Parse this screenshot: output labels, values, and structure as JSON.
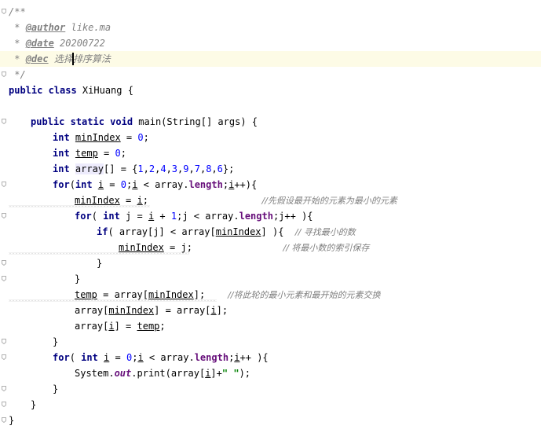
{
  "lines": [
    {
      "indent": 0,
      "tokens": [
        {
          "t": "/**",
          "c": "doc"
        }
      ]
    },
    {
      "indent": 0,
      "tokens": [
        {
          "t": " * ",
          "c": "doc"
        },
        {
          "t": "@author",
          "c": "tag"
        },
        {
          "t": " like.ma",
          "c": "doc"
        }
      ]
    },
    {
      "indent": 0,
      "tokens": [
        {
          "t": " * ",
          "c": "doc"
        },
        {
          "t": "@date",
          "c": "tag"
        },
        {
          "t": " 20200722",
          "c": "doc"
        }
      ]
    },
    {
      "indent": 0,
      "tokens": [
        {
          "t": " * ",
          "c": "doc"
        },
        {
          "t": "@dec",
          "c": "tag"
        },
        {
          "t": " 选择排序算法",
          "c": "doc"
        }
      ]
    },
    {
      "indent": 0,
      "tokens": [
        {
          "t": " */",
          "c": "doc"
        }
      ]
    },
    {
      "indent": 0,
      "tokens": [
        {
          "t": "public class ",
          "c": "kw"
        },
        {
          "t": "XiHuang {",
          "c": ""
        }
      ]
    },
    {
      "indent": 0,
      "tokens": []
    },
    {
      "indent": 1,
      "tokens": [
        {
          "t": "public static void ",
          "c": "kw"
        },
        {
          "t": "main(String[] args) {",
          "c": ""
        }
      ]
    },
    {
      "indent": 2,
      "tokens": [
        {
          "t": "int ",
          "c": "kw"
        },
        {
          "t": "minIndex",
          "c": "ul"
        },
        {
          "t": " = ",
          "c": ""
        },
        {
          "t": "0",
          "c": "num"
        },
        {
          "t": ";",
          "c": ""
        }
      ]
    },
    {
      "indent": 2,
      "tokens": [
        {
          "t": "int ",
          "c": "kw"
        },
        {
          "t": "temp",
          "c": "ul"
        },
        {
          "t": " = ",
          "c": ""
        },
        {
          "t": "0",
          "c": "num"
        },
        {
          "t": ";",
          "c": ""
        }
      ]
    },
    {
      "indent": 2,
      "tokens": [
        {
          "t": "int ",
          "c": "kw"
        },
        {
          "t": "array",
          "c": "hl"
        },
        {
          "t": "[] = {",
          "c": ""
        },
        {
          "t": "1",
          "c": "num"
        },
        {
          "t": ",",
          "c": ""
        },
        {
          "t": "2",
          "c": "num"
        },
        {
          "t": ",",
          "c": ""
        },
        {
          "t": "4",
          "c": "num"
        },
        {
          "t": ",",
          "c": ""
        },
        {
          "t": "3",
          "c": "num"
        },
        {
          "t": ",",
          "c": ""
        },
        {
          "t": "9",
          "c": "num"
        },
        {
          "t": ",",
          "c": ""
        },
        {
          "t": "7",
          "c": "num"
        },
        {
          "t": ",",
          "c": ""
        },
        {
          "t": "8",
          "c": "num"
        },
        {
          "t": ",",
          "c": ""
        },
        {
          "t": "6",
          "c": "num"
        },
        {
          "t": "};",
          "c": ""
        }
      ]
    },
    {
      "indent": 2,
      "tokens": [
        {
          "t": "for",
          "c": "kw"
        },
        {
          "t": "(",
          "c": ""
        },
        {
          "t": "int ",
          "c": "kw"
        },
        {
          "t": "i",
          "c": "ul"
        },
        {
          "t": " = ",
          "c": ""
        },
        {
          "t": "0",
          "c": "num"
        },
        {
          "t": ";",
          "c": ""
        },
        {
          "t": "i",
          "c": "ul"
        },
        {
          "t": " < array.",
          "c": ""
        },
        {
          "t": "length",
          "c": "fld"
        },
        {
          "t": ";",
          "c": ""
        },
        {
          "t": "i",
          "c": "ul"
        },
        {
          "t": "++){",
          "c": ""
        }
      ]
    },
    {
      "indent": 3,
      "tokens": [
        {
          "t": "minIndex",
          "c": "ul"
        },
        {
          "t": " = ",
          "c": ""
        },
        {
          "t": "i",
          "c": "ul"
        },
        {
          "t": ";                    ",
          "c": ""
        },
        {
          "t": "//先假设最开始的元素为最小的元素",
          "c": "cmt-cn"
        }
      ]
    },
    {
      "indent": 3,
      "tokens": [
        {
          "t": "for",
          "c": "kw"
        },
        {
          "t": "( ",
          "c": ""
        },
        {
          "t": "int ",
          "c": "kw"
        },
        {
          "t": "j = ",
          "c": ""
        },
        {
          "t": "i",
          "c": "ul"
        },
        {
          "t": " + ",
          "c": ""
        },
        {
          "t": "1",
          "c": "num"
        },
        {
          "t": ";j < array.",
          "c": ""
        },
        {
          "t": "length",
          "c": "fld"
        },
        {
          "t": ";j++ ){",
          "c": ""
        }
      ]
    },
    {
      "indent": 4,
      "tokens": [
        {
          "t": "if",
          "c": "kw"
        },
        {
          "t": "( array[j] < array[",
          "c": ""
        },
        {
          "t": "minIndex",
          "c": "ul"
        },
        {
          "t": "] ){  ",
          "c": ""
        },
        {
          "t": "// 寻找最小的数",
          "c": "cmt-cn"
        }
      ]
    },
    {
      "indent": 5,
      "tokens": [
        {
          "t": "minIndex",
          "c": "ul"
        },
        {
          "t": " = j;                ",
          "c": ""
        },
        {
          "t": "// 将最小数的索引保存",
          "c": "cmt-cn"
        }
      ]
    },
    {
      "indent": 4,
      "tokens": [
        {
          "t": "}",
          "c": ""
        }
      ]
    },
    {
      "indent": 3,
      "tokens": [
        {
          "t": "}",
          "c": ""
        }
      ]
    },
    {
      "indent": 3,
      "tokens": [
        {
          "t": "temp",
          "c": "ul"
        },
        {
          "t": " = array[",
          "c": ""
        },
        {
          "t": "minIndex",
          "c": "ul"
        },
        {
          "t": "];    ",
          "c": ""
        },
        {
          "t": "//将此轮的最小元素和最开始的元素交换",
          "c": "cmt-cn"
        }
      ]
    },
    {
      "indent": 3,
      "tokens": [
        {
          "t": "array[",
          "c": ""
        },
        {
          "t": "minIndex",
          "c": "ul"
        },
        {
          "t": "] = array[",
          "c": ""
        },
        {
          "t": "i",
          "c": "ul"
        },
        {
          "t": "];",
          "c": ""
        }
      ]
    },
    {
      "indent": 3,
      "tokens": [
        {
          "t": "array[",
          "c": ""
        },
        {
          "t": "i",
          "c": "ul"
        },
        {
          "t": "] = ",
          "c": ""
        },
        {
          "t": "temp",
          "c": "ul"
        },
        {
          "t": ";",
          "c": ""
        }
      ]
    },
    {
      "indent": 2,
      "tokens": [
        {
          "t": "}",
          "c": ""
        }
      ]
    },
    {
      "indent": 2,
      "tokens": [
        {
          "t": "for",
          "c": "kw"
        },
        {
          "t": "( ",
          "c": ""
        },
        {
          "t": "int ",
          "c": "kw"
        },
        {
          "t": "i",
          "c": "ul"
        },
        {
          "t": " = ",
          "c": ""
        },
        {
          "t": "0",
          "c": "num"
        },
        {
          "t": ";",
          "c": ""
        },
        {
          "t": "i",
          "c": "ul"
        },
        {
          "t": " < array.",
          "c": ""
        },
        {
          "t": "length",
          "c": "fld"
        },
        {
          "t": ";",
          "c": ""
        },
        {
          "t": "i",
          "c": "ul"
        },
        {
          "t": "++ ){",
          "c": ""
        }
      ]
    },
    {
      "indent": 3,
      "tokens": [
        {
          "t": "System.",
          "c": ""
        },
        {
          "t": "out",
          "c": "sfld"
        },
        {
          "t": ".print(array[",
          "c": ""
        },
        {
          "t": "i",
          "c": "ul"
        },
        {
          "t": "]+",
          "c": ""
        },
        {
          "t": "\" \"",
          "c": "str"
        },
        {
          "t": ");",
          "c": ""
        }
      ]
    },
    {
      "indent": 2,
      "tokens": [
        {
          "t": "}",
          "c": ""
        }
      ]
    },
    {
      "indent": 1,
      "tokens": [
        {
          "t": "}",
          "c": ""
        }
      ]
    },
    {
      "indent": 0,
      "tokens": [
        {
          "t": "}",
          "c": ""
        }
      ]
    }
  ],
  "highlight_line": 3,
  "fold_lines": [
    0,
    4,
    7,
    11,
    13,
    16,
    17,
    21,
    22,
    24,
    25,
    26
  ],
  "colors": {
    "keyword": "#000080",
    "number": "#0000ff",
    "comment": "#808080",
    "field": "#660e7a",
    "string": "#008000",
    "current_line": "#fdfbe6"
  }
}
